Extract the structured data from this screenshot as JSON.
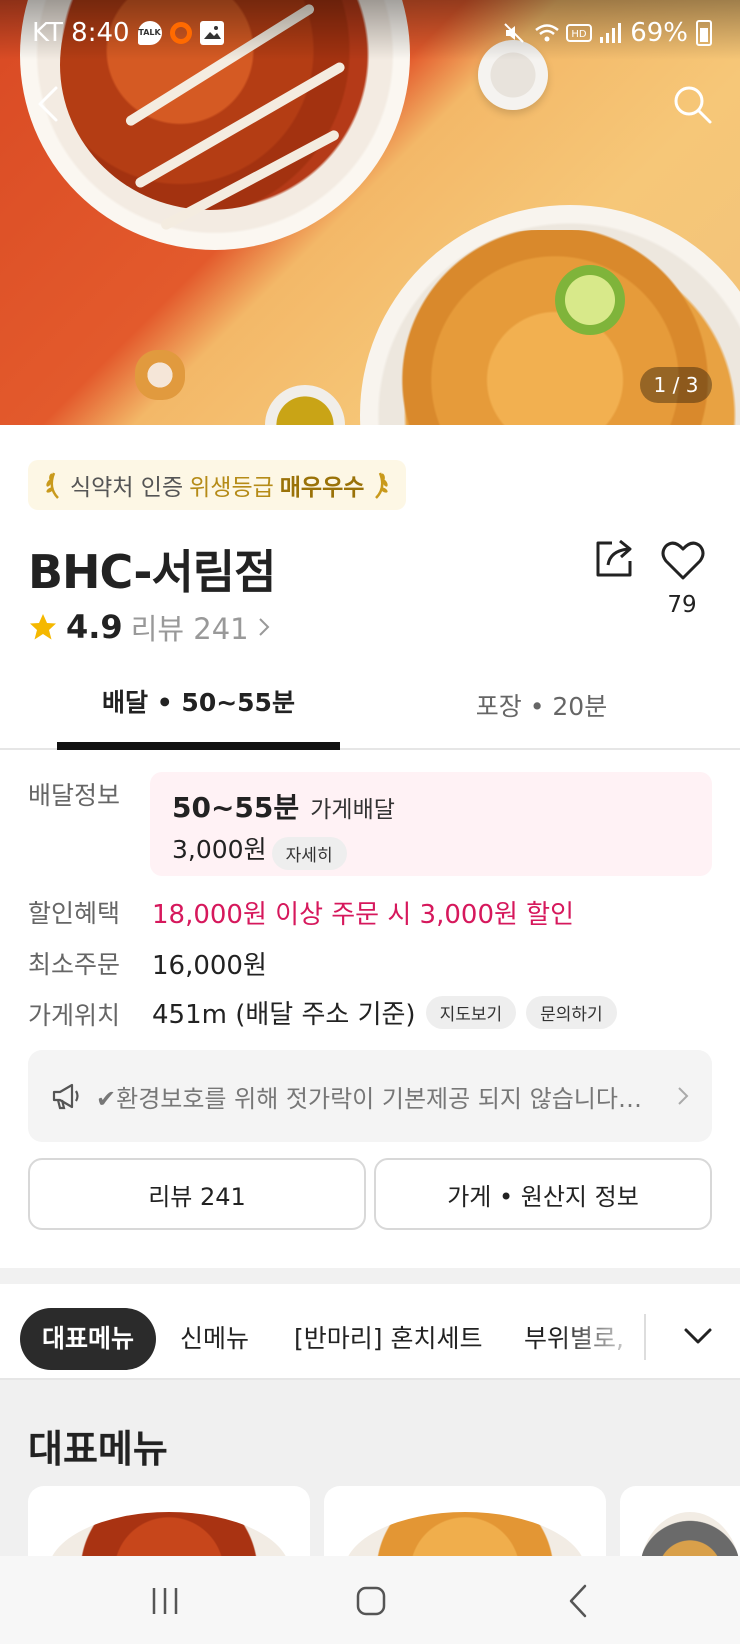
{
  "status_bar": {
    "carrier_time": "KT 8:40",
    "talk_label": "TALK",
    "battery": "69%"
  },
  "hero": {
    "counter": "1 / 3"
  },
  "store": {
    "badge": {
      "part1": "식약처 인증",
      "part2": "위생등급",
      "part3": "매우우수"
    },
    "name": "BHC-서림점",
    "rating": "4.9",
    "reviews_link": "리뷰 241",
    "likes": "79"
  },
  "tabs": [
    {
      "label": "배달 • 50~55분",
      "active": true
    },
    {
      "label": "포장 • 20분",
      "active": false
    }
  ],
  "info": {
    "delivery_label": "배달정보",
    "delivery_time": "50~55분",
    "delivery_type": "가게배달",
    "delivery_fee": "3,000원",
    "detail_chip": "자세히",
    "discount_label": "할인혜택",
    "discount_value": "18,000원 이상 주문 시 3,000원 할인",
    "min_order_label": "최소주문",
    "min_order_value": "16,000원",
    "location_label": "가게위치",
    "location_value": "451m (배달 주소 기준)",
    "map_chip": "지도보기",
    "inquiry_chip": "문의하기"
  },
  "notice": {
    "text": "✔환경보호를 위해 젓가락이 기본제공 되지 않습니다젓..."
  },
  "buttons": {
    "reviews": "리뷰 241",
    "store_info": "가게 • 원산지 정보"
  },
  "categories": [
    {
      "label": "대표메뉴",
      "active": true
    },
    {
      "label": "신메뉴",
      "active": false
    },
    {
      "label": "[반마리] 혼치세트",
      "active": false
    },
    {
      "label": "부위별로, ",
      "active": false
    }
  ],
  "menu_section": {
    "heading": "대표메뉴"
  },
  "colors": {
    "discount": "#d6185c",
    "delivery_box": "#fff2f5",
    "badge_bg": "#fdf7e5",
    "badge_gold": "#b58b17",
    "star": "#f5b800"
  }
}
